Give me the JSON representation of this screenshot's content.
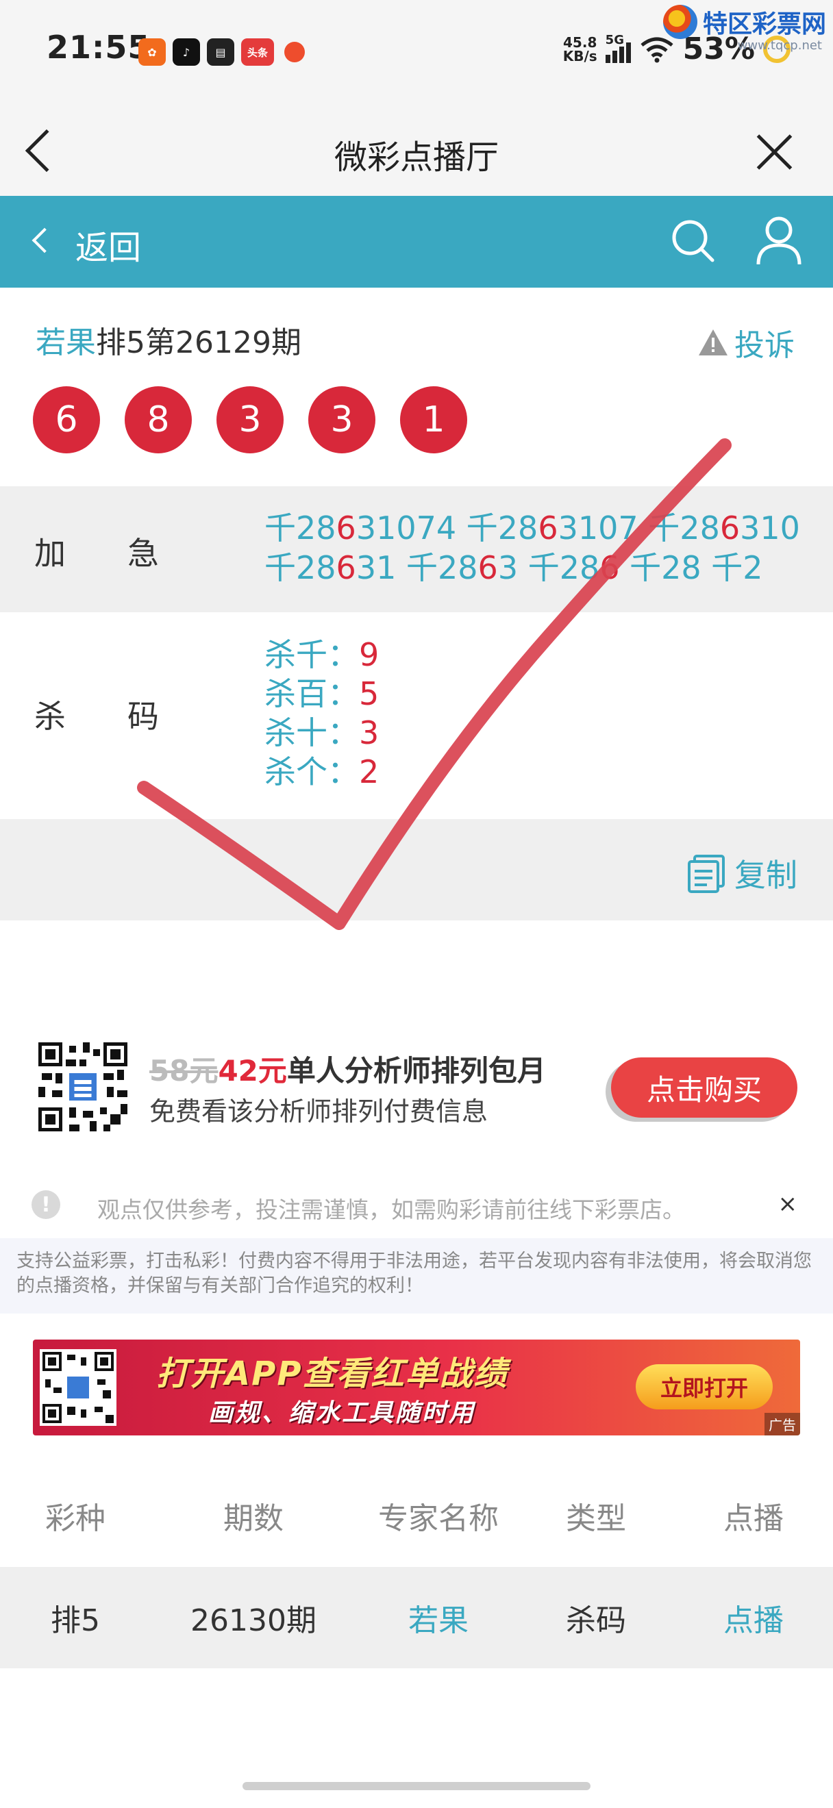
{
  "status": {
    "time": "21:55",
    "apps": [
      {
        "icon": "app-icon-orange",
        "label": "",
        "color": "#f26b1d"
      },
      {
        "icon": "tiktok-icon",
        "label": "♪",
        "color": "#111111"
      },
      {
        "icon": "app-icon-news",
        "label": "",
        "color": "#222222"
      },
      {
        "icon": "app-icon-toutiao",
        "label": "头条",
        "color": "#e43b3b"
      },
      {
        "icon": "app-icon-orange-dot",
        "label": "",
        "color": "#ee4d2d"
      }
    ],
    "net_speed_value": "45.8",
    "net_speed_unit": "KB/s",
    "network": "5G",
    "battery": "53%"
  },
  "watermark": {
    "name": "特区彩票网",
    "url": "www.tqcp.net"
  },
  "nav": {
    "title": "微彩点播厅"
  },
  "header": {
    "back_label": "返回"
  },
  "issue": {
    "author": "若果",
    "title_rest": "排5第26129期",
    "complain_label": "投诉",
    "balls": [
      "6",
      "8",
      "3",
      "3",
      "1"
    ]
  },
  "rows": {
    "jiaji": {
      "label": "加急",
      "line1": [
        {
          "t": "千28"
        },
        {
          "t": "6",
          "red": true
        },
        {
          "t": "31074 千28"
        },
        {
          "t": "6",
          "red": true
        },
        {
          "t": "3107 千28"
        },
        {
          "t": "6",
          "red": true
        },
        {
          "t": "310"
        }
      ],
      "line2": [
        {
          "t": "千28"
        },
        {
          "t": "6",
          "red": true
        },
        {
          "t": "31 千28"
        },
        {
          "t": "6",
          "red": true
        },
        {
          "t": "3 千28"
        },
        {
          "t": "6",
          "red": true
        },
        {
          "t": " 千28 千2"
        }
      ]
    },
    "shama": {
      "label": "杀码",
      "items": [
        {
          "k": "杀千：",
          "v": "9"
        },
        {
          "k": "杀百：",
          "v": "5"
        },
        {
          "k": "杀十：",
          "v": "3"
        },
        {
          "k": "杀个：",
          "v": "2"
        }
      ]
    },
    "copy_label": "复制"
  },
  "promo": {
    "old_price": "58元",
    "new_price": "42元",
    "title": "单人分析师排列包月",
    "subtitle": "免费看该分析师排列付费信息",
    "buy_label": "点击购买"
  },
  "notice": {
    "text": "观点仅供参考，投注需谨慎，如需购彩请前往线下彩票店。",
    "close": "×"
  },
  "legal": "支持公益彩票，打击私彩！付费内容不得用于非法用途，若平台发现内容有非法使用，将会取消您的点播资格，并保留与有关部门合作追究的权利！",
  "banner": {
    "line1": "打开APP查看红单战绩",
    "line2": "画规、缩水工具随时用",
    "button": "立即打开",
    "ad_tag": "广告"
  },
  "table": {
    "headers": [
      "彩种",
      "期数",
      "专家名称",
      "类型",
      "点播"
    ],
    "rows": [
      [
        "排5",
        "26130期",
        "若果",
        "杀码",
        "点播"
      ]
    ]
  },
  "colors": {
    "accent": "#3aa8c1",
    "ball": "#d8283a",
    "buy": "#e94344",
    "check": "#d9424f"
  }
}
